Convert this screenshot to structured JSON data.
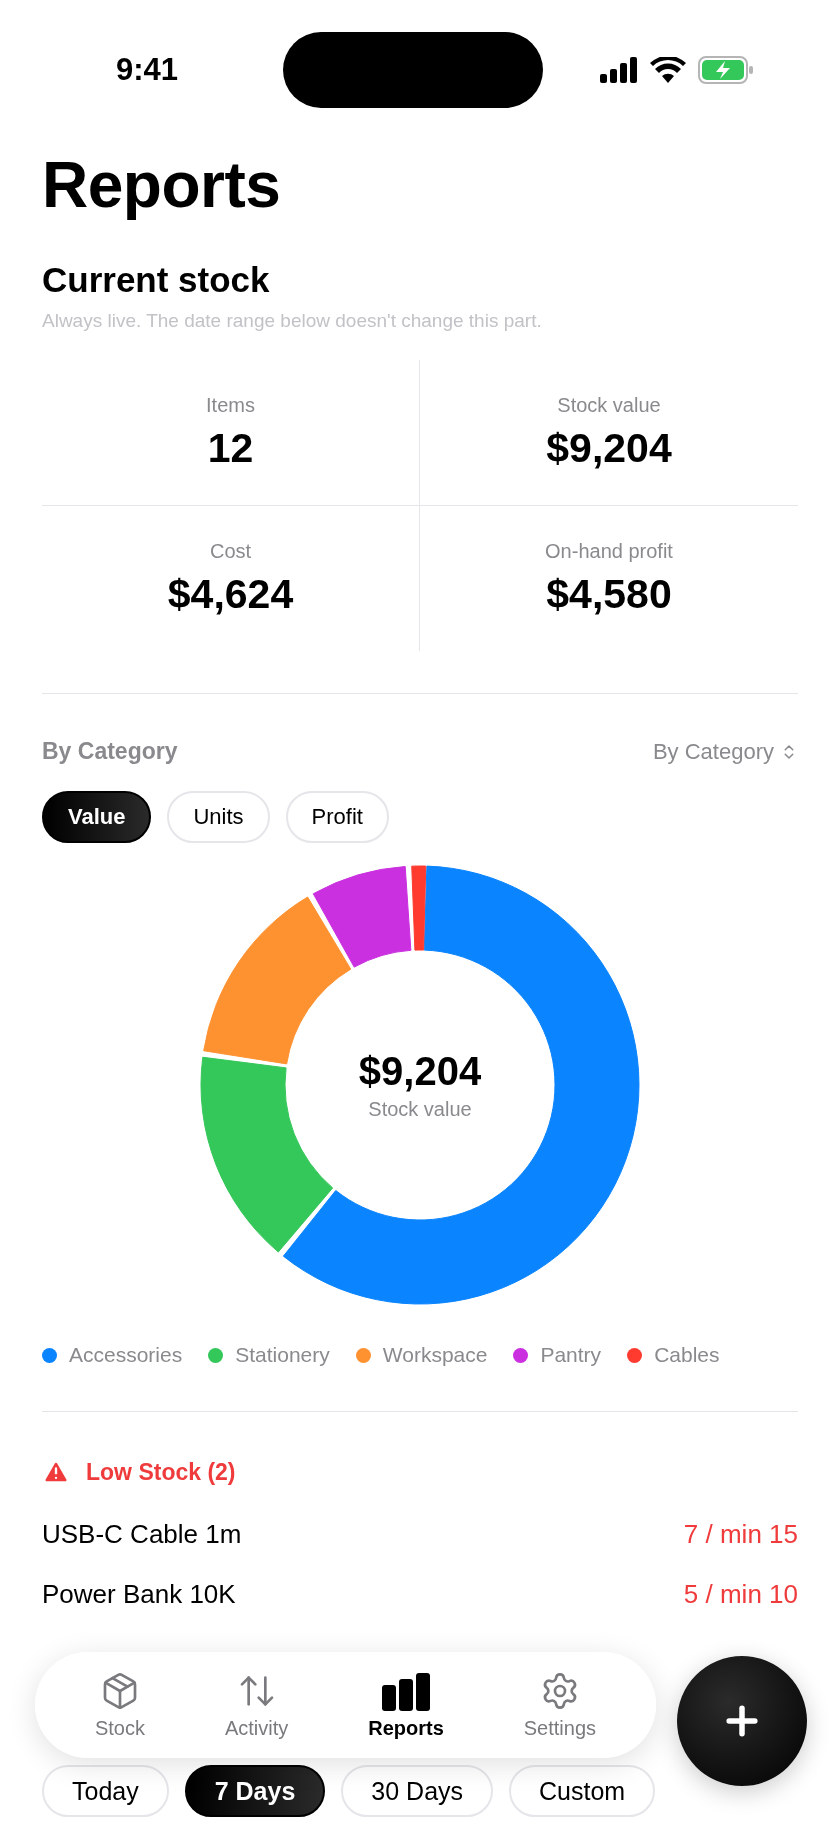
{
  "status_bar": {
    "time": "9:41"
  },
  "title": "Reports",
  "current_stock": {
    "heading": "Current stock",
    "note": "Always live. The date range below doesn't change this part.",
    "metrics": [
      {
        "label": "Items",
        "value": "12"
      },
      {
        "label": "Stock value",
        "value": "$9,204"
      },
      {
        "label": "Cost",
        "value": "$4,624"
      },
      {
        "label": "On-hand profit",
        "value": "$4,580"
      }
    ]
  },
  "by_category": {
    "heading": "By Category",
    "sort": "By Category",
    "chips": [
      {
        "label": "Value",
        "selected": true
      },
      {
        "label": "Units",
        "selected": false
      },
      {
        "label": "Profit",
        "selected": false
      }
    ],
    "donut": {
      "total": "$9,204",
      "caption": "Stock value"
    },
    "legend": [
      {
        "label": "Accessories",
        "color": "#0a84ff"
      },
      {
        "label": "Stationery",
        "color": "#34c759"
      },
      {
        "label": "Workspace",
        "color": "#ff9230"
      },
      {
        "label": "Pantry",
        "color": "#cb30e0"
      },
      {
        "label": "Cables",
        "color": "#ff3b30"
      }
    ]
  },
  "low_stock": {
    "heading": "Low Stock (2)",
    "rows": [
      {
        "name": "USB-C Cable 1m",
        "reading": "7 / min 15"
      },
      {
        "name": "Power Bank 10K",
        "reading": "5 / min 10"
      }
    ]
  },
  "range_chips": [
    {
      "label": "Today",
      "selected": false
    },
    {
      "label": "7 Days",
      "selected": true
    },
    {
      "label": "30 Days",
      "selected": false
    },
    {
      "label": "Custom",
      "selected": false
    }
  ],
  "tab_bar": [
    {
      "label": "Stock",
      "kind": "box",
      "selected": false
    },
    {
      "label": "Activity",
      "kind": "arrows",
      "selected": false
    },
    {
      "label": "Reports",
      "kind": "bars",
      "selected": true
    },
    {
      "label": "Settings",
      "kind": "gear",
      "selected": false
    }
  ]
}
